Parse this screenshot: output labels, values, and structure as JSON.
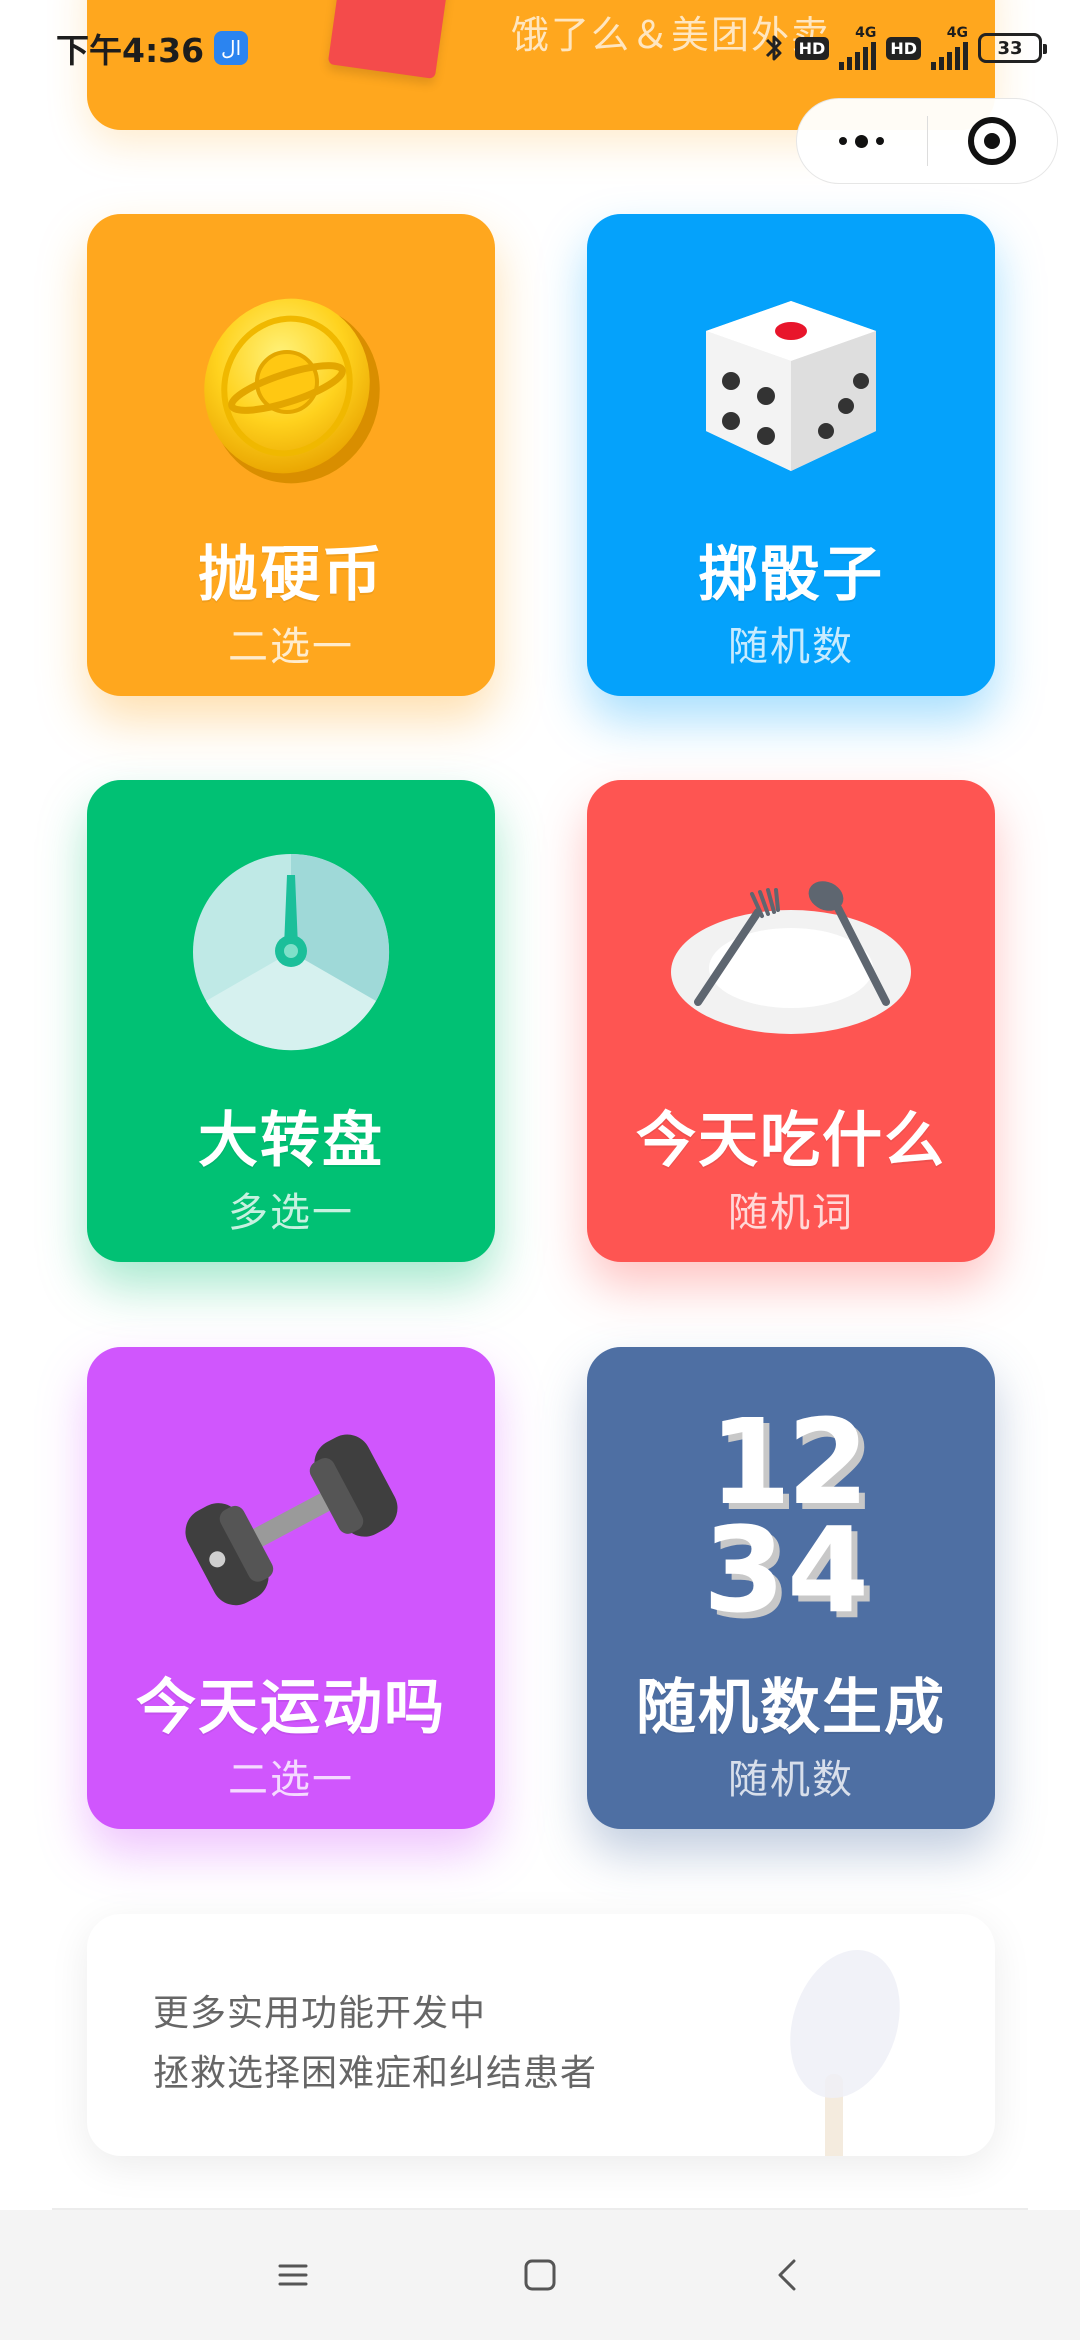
{
  "status_bar": {
    "time": "下午4:36",
    "app_badge": "ال",
    "network_1": "4G",
    "network_2": "4G",
    "hd_1": "HD",
    "hd_2": "HD",
    "battery": "33"
  },
  "banner": {
    "text": "饿了么＆美团外卖"
  },
  "cards": [
    {
      "title": "抛硬币",
      "subtitle": "二选一",
      "color": "#FFA71E",
      "icon": "coin-icon"
    },
    {
      "title": "掷骰子",
      "subtitle": "随机数",
      "color": "#05A2FB",
      "icon": "dice-icon"
    },
    {
      "title": "大转盘",
      "subtitle": "多选一",
      "color": "#01C174",
      "icon": "wheel-icon"
    },
    {
      "title": "今天吃什么",
      "subtitle": "随机词",
      "color": "#FE5552",
      "icon": "plate-icon"
    },
    {
      "title": "今天运动吗",
      "subtitle": "二选一",
      "color": "#D056FD",
      "icon": "dumbbell-icon"
    },
    {
      "title": "随机数生成",
      "subtitle": "随机数",
      "color": "#4E6FA3",
      "icon": "numbers-icon"
    }
  ],
  "info": {
    "line1": "更多实用功能开发中",
    "line2": "拯救选择困难症和纠结患者"
  },
  "numbers_icon": {
    "a": "1",
    "b": "2",
    "c": "3",
    "d": "4"
  }
}
